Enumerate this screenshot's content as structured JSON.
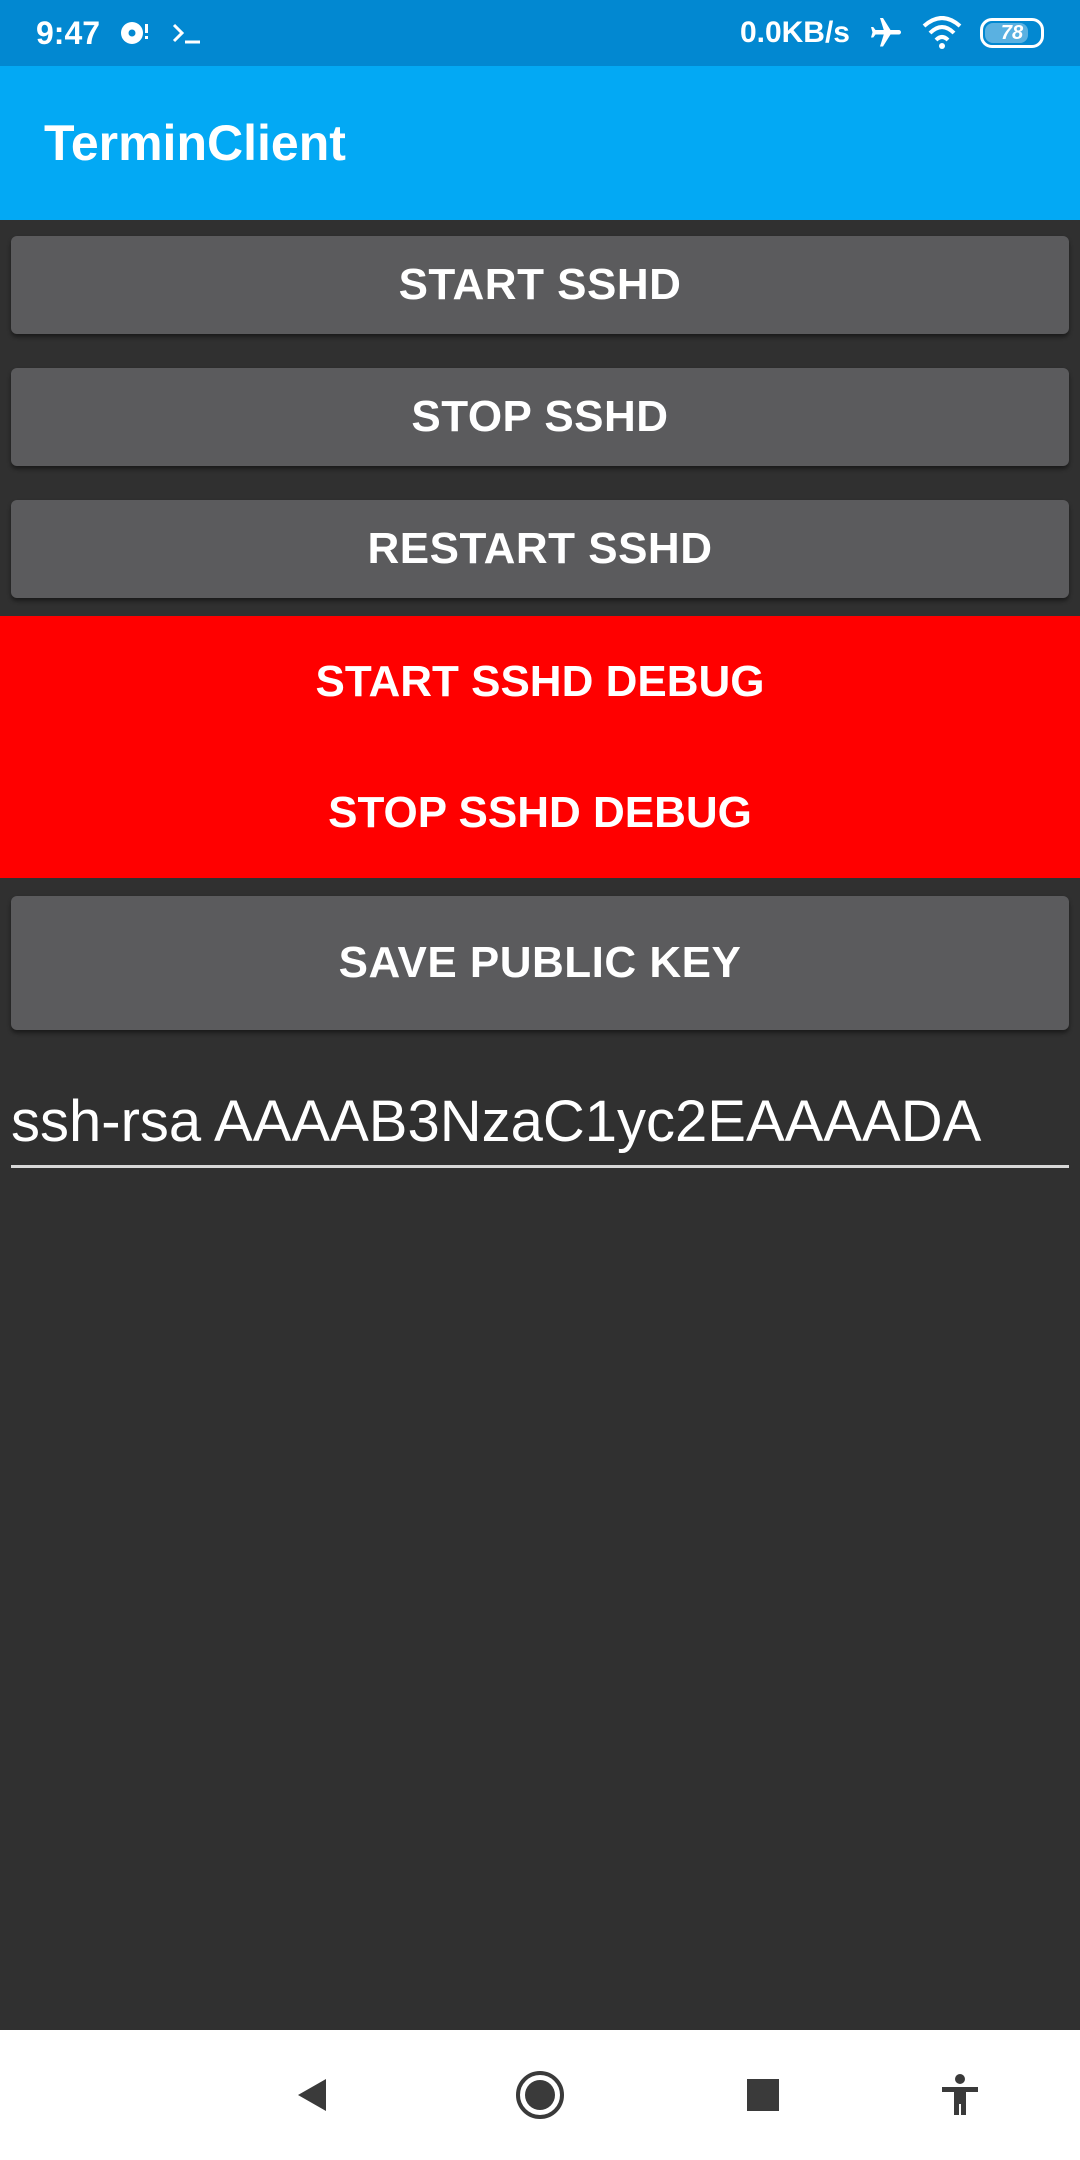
{
  "status_bar": {
    "time": "9:47",
    "net_speed": "0.0KB/s",
    "battery_level": "78",
    "icons": [
      "media-icon",
      "terminal-icon",
      "airplane-icon",
      "wifi-icon",
      "battery-icon"
    ]
  },
  "app": {
    "title": "TerminClient",
    "bar_color": "#03a9f4",
    "status_color": "#0288d1"
  },
  "buttons": {
    "start_sshd": "START SSHD",
    "stop_sshd": "STOP SSHD",
    "restart_sshd": "RESTART SSHD",
    "start_debug": "START SSHD DEBUG",
    "stop_debug": "STOP SSHD DEBUG",
    "save_key": "SAVE PUBLIC KEY",
    "debug_color": "#ff0000",
    "button_color": "#5b5b5d"
  },
  "public_key": {
    "value": "ssh-rsa AAAAB3NzaC1yc2EAAAADA"
  },
  "nav_bar": {
    "icons": [
      "back-icon",
      "home-icon",
      "recents-icon",
      "accessibility-icon"
    ]
  }
}
